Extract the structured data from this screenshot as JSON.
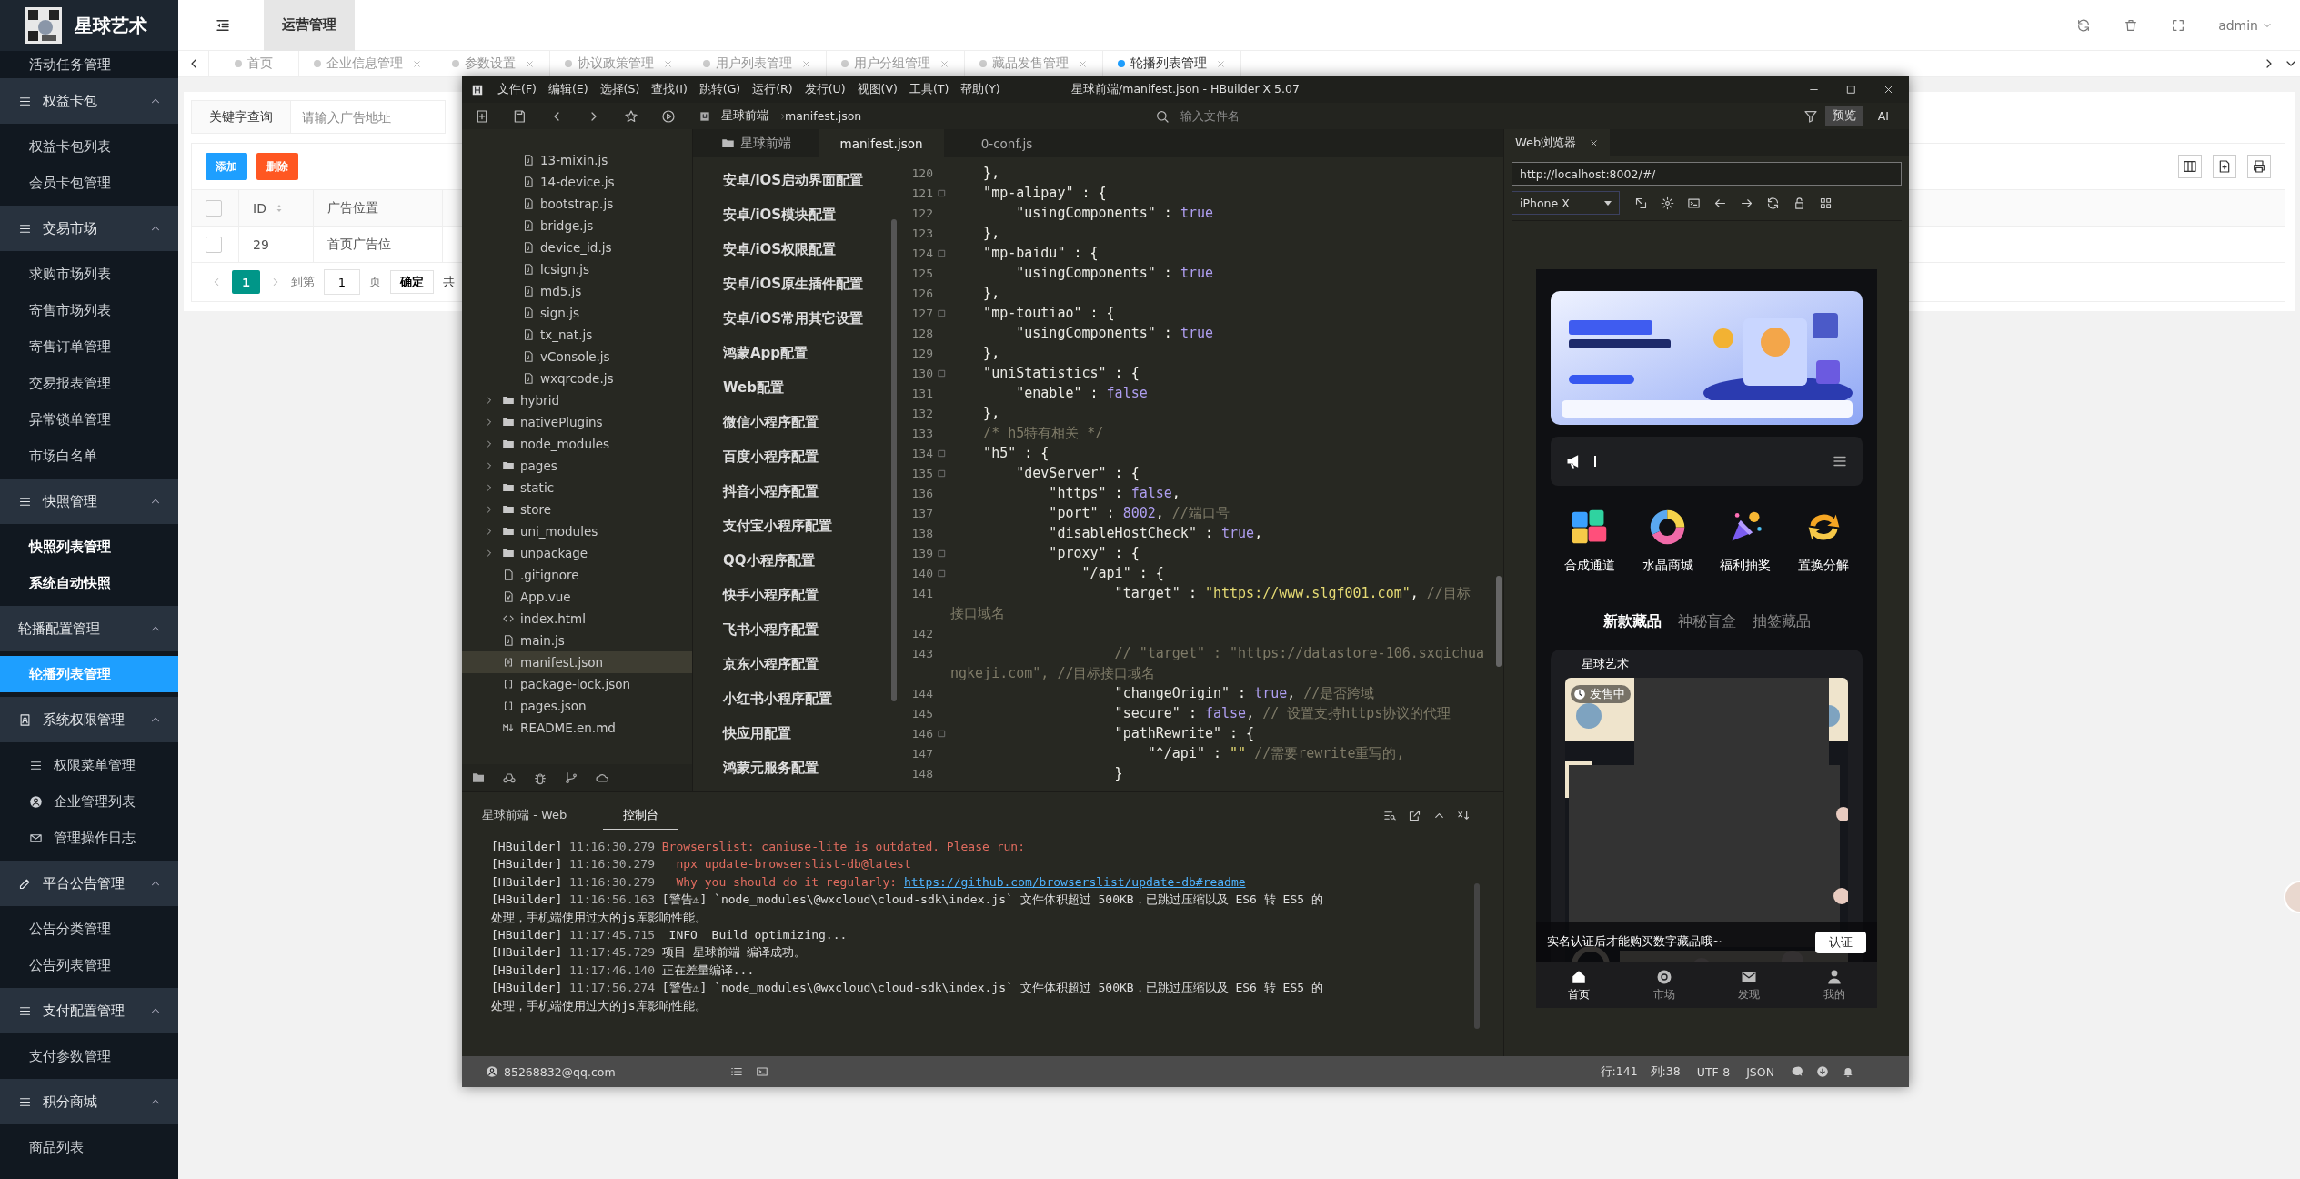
{
  "admin": {
    "logo": "星球艺术",
    "sidebar": {
      "partial_item": "活动任务管理",
      "groups": [
        {
          "title": "权益卡包",
          "kind": "list",
          "expanded": true,
          "items": [
            {
              "label": "权益卡包列表",
              "selected": false,
              "emphasized": false
            },
            {
              "label": "会员卡包管理",
              "selected": false,
              "emphasized": false
            }
          ]
        },
        {
          "title": "交易市场",
          "kind": "list",
          "expanded": true,
          "items": [
            {
              "label": "求购市场列表",
              "selected": false,
              "emphasized": false
            },
            {
              "label": "寄售市场列表",
              "selected": false,
              "emphasized": false
            },
            {
              "label": "寄售订单管理",
              "selected": false,
              "emphasized": false
            },
            {
              "label": "交易报表管理",
              "selected": false,
              "emphasized": false
            },
            {
              "label": "异常锁单管理",
              "selected": false,
              "emphasized": false
            },
            {
              "label": "市场白名单",
              "selected": false,
              "emphasized": false
            }
          ]
        },
        {
          "title": "快照管理",
          "kind": "list",
          "expanded": true,
          "items": [
            {
              "label": "快照列表管理",
              "selected": false,
              "emphasized": true
            },
            {
              "label": "系统自动快照",
              "selected": false,
              "emphasized": true
            }
          ]
        },
        {
          "title": "轮播配置管理",
          "kind": "plain",
          "expanded": true,
          "items": [
            {
              "label": "轮播列表管理",
              "selected": true
            }
          ]
        },
        {
          "title": "系统权限管理",
          "kind": "contact",
          "expanded": true,
          "items": [
            {
              "label": "权限菜单管理",
              "kind": "list",
              "selected": false,
              "emphasized": false
            },
            {
              "label": "企业管理列表",
              "kind": "user",
              "selected": false,
              "emphasized": false
            },
            {
              "label": "管理操作日志",
              "kind": "mail",
              "selected": false,
              "emphasized": false
            }
          ]
        },
        {
          "title": "平台公告管理",
          "kind": "edit",
          "expanded": true,
          "items": [
            {
              "label": "公告分类管理",
              "selected": false,
              "emphasized": false
            },
            {
              "label": "公告列表管理",
              "selected": false,
              "emphasized": false
            }
          ]
        },
        {
          "title": "支付配置管理",
          "kind": "list",
          "expanded": true,
          "items": [
            {
              "label": "支付参数管理",
              "selected": false,
              "emphasized": false
            }
          ]
        },
        {
          "title": "积分商城",
          "kind": "list",
          "expanded": true,
          "items": [
            {
              "label": "商品列表",
              "selected": false,
              "emphasized": false
            }
          ]
        }
      ]
    },
    "top_menu": "运营管理",
    "user": "admin",
    "tabs": [
      {
        "label": "首页",
        "closable": false,
        "selected": false
      },
      {
        "label": "企业信息管理",
        "closable": true,
        "selected": false
      },
      {
        "label": "参数设置",
        "closable": true,
        "selected": false
      },
      {
        "label": "协议政策管理",
        "closable": true,
        "selected": false
      },
      {
        "label": "用户列表管理",
        "closable": true,
        "selected": false
      },
      {
        "label": "用户分组管理",
        "closable": true,
        "selected": false
      },
      {
        "label": "藏品发售管理",
        "closable": true,
        "selected": false
      },
      {
        "label": "轮播列表管理",
        "closable": true,
        "selected": true
      }
    ],
    "search": {
      "label": "关键字查询",
      "placeholder": "请输入广告地址"
    },
    "actions": [
      {
        "label": "添加",
        "kind": "primary"
      },
      {
        "label": "删除",
        "kind": "danger"
      }
    ],
    "table": {
      "header_checked": false,
      "columns": [
        "ID",
        "广告位置"
      ],
      "rows": [
        {
          "checked": false,
          "cells": [
            "29",
            "首页广告位"
          ]
        }
      ]
    },
    "pagination": {
      "pages": [
        {
          "label": "1",
          "selected": true
        }
      ],
      "goto_label": "到第",
      "goto_value": "1",
      "page_unit": "页",
      "confirm": "确定",
      "total": "共"
    }
  },
  "ide": {
    "title": "星球前端/manifest.json - HBuilder X 5.07",
    "menus": [
      "文件(F)",
      "编辑(E)",
      "选择(S)",
      "查找(I)",
      "跳转(G)",
      "运行(R)",
      "发行(U)",
      "视图(V)",
      "工具(T)",
      "帮助(Y)"
    ],
    "breadcrumb": [
      "星球前端",
      "manifest.json"
    ],
    "file_search_placeholder": "输入文件名",
    "preview_button": "预览",
    "ai_button": "AI",
    "file_tree": {
      "inner_files": [
        {
          "name": "13-mixin.js",
          "kind": "file",
          "selected": false
        },
        {
          "name": "14-device.js",
          "kind": "file",
          "selected": false
        },
        {
          "name": "bootstrap.js",
          "kind": "file",
          "selected": false
        },
        {
          "name": "bridge.js",
          "kind": "file",
          "selected": false
        },
        {
          "name": "device_id.js",
          "kind": "file",
          "selected": false
        },
        {
          "name": "lcsign.js",
          "kind": "file",
          "selected": false
        },
        {
          "name": "md5.js",
          "kind": "file",
          "selected": false
        },
        {
          "name": "sign.js",
          "kind": "file",
          "selected": false
        },
        {
          "name": "tx_nat.js",
          "kind": "file",
          "selected": false
        },
        {
          "name": "vConsole.js",
          "kind": "file",
          "selected": false
        },
        {
          "name": "wxqrcode.js",
          "kind": "file",
          "selected": false
        }
      ],
      "items": [
        {
          "name": "hybrid",
          "kind": "folder",
          "expanded": false,
          "selected": false
        },
        {
          "name": "nativePlugins",
          "kind": "folder",
          "expanded": false,
          "selected": false
        },
        {
          "name": "node_modules",
          "kind": "folder",
          "expanded": false,
          "selected": false
        },
        {
          "name": "pages",
          "kind": "folder",
          "expanded": false,
          "selected": false
        },
        {
          "name": "static",
          "kind": "folder",
          "expanded": false,
          "selected": false
        },
        {
          "name": "store",
          "kind": "folder",
          "expanded": false,
          "selected": false
        },
        {
          "name": "uni_modules",
          "kind": "folder",
          "expanded": false,
          "selected": false
        },
        {
          "name": "unpackage",
          "kind": "folder",
          "expanded": false,
          "selected": false
        },
        {
          "name": ".gitignore",
          "kind": "blank",
          "selected": false
        },
        {
          "name": "App.vue",
          "kind": "vue",
          "selected": false
        },
        {
          "name": "index.html",
          "kind": "html",
          "selected": false
        },
        {
          "name": "main.js",
          "kind": "file",
          "selected": false
        },
        {
          "name": "manifest.json",
          "kind": "manifest",
          "selected": true
        },
        {
          "name": "package-lock.json",
          "kind": "json",
          "selected": false
        },
        {
          "name": "pages.json",
          "kind": "json",
          "selected": false
        },
        {
          "name": "README.en.md",
          "kind": "md",
          "selected": false
        }
      ]
    },
    "editor_tabs": [
      {
        "label": "星球前端",
        "kind": "folder",
        "selected": false
      },
      {
        "label": "manifest.json",
        "kind": "file",
        "selected": true
      },
      {
        "label": "0-conf.js",
        "kind": "file",
        "selected": false
      }
    ],
    "manifest_sections": [
      "安卓/iOS启动界面配置",
      "安卓/iOS模块配置",
      "安卓/iOS权限配置",
      "安卓/iOS原生插件配置",
      "安卓/iOS常用其它设置",
      "鸿蒙App配置",
      "Web配置",
      "微信小程序配置",
      "百度小程序配置",
      "抖音小程序配置",
      "支付宝小程序配置",
      "QQ小程序配置",
      "快手小程序配置",
      "飞书小程序配置",
      "京东小程序配置",
      "小红书小程序配置",
      "快应用配置",
      "鸿蒙元服务配置"
    ],
    "code_lines": [
      {
        "no": "120",
        "fold": false,
        "tokens": [
          {
            "kind": "punct",
            "text": "    },"
          }
        ]
      },
      {
        "no": "121",
        "fold": true,
        "tokens": [
          {
            "kind": "key",
            "text": "    \"mp-alipay\""
          },
          {
            "kind": "punct",
            "text": " : {"
          }
        ]
      },
      {
        "no": "122",
        "fold": false,
        "tokens": [
          {
            "kind": "key",
            "text": "        \"usingComponents\""
          },
          {
            "kind": "punct",
            "text": " : "
          },
          {
            "kind": "literal",
            "text": "true"
          }
        ]
      },
      {
        "no": "123",
        "fold": false,
        "tokens": [
          {
            "kind": "punct",
            "text": "    },"
          }
        ]
      },
      {
        "no": "124",
        "fold": true,
        "tokens": [
          {
            "kind": "key",
            "text": "    \"mp-baidu\""
          },
          {
            "kind": "punct",
            "text": " : {"
          }
        ]
      },
      {
        "no": "125",
        "fold": false,
        "tokens": [
          {
            "kind": "key",
            "text": "        \"usingComponents\""
          },
          {
            "kind": "punct",
            "text": " : "
          },
          {
            "kind": "literal",
            "text": "true"
          }
        ]
      },
      {
        "no": "126",
        "fold": false,
        "tokens": [
          {
            "kind": "punct",
            "text": "    },"
          }
        ]
      },
      {
        "no": "127",
        "fold": true,
        "tokens": [
          {
            "kind": "key",
            "text": "    \"mp-toutiao\""
          },
          {
            "kind": "punct",
            "text": " : {"
          }
        ]
      },
      {
        "no": "128",
        "fold": false,
        "tokens": [
          {
            "kind": "key",
            "text": "        \"usingComponents\""
          },
          {
            "kind": "punct",
            "text": " : "
          },
          {
            "kind": "literal",
            "text": "true"
          }
        ]
      },
      {
        "no": "129",
        "fold": false,
        "tokens": [
          {
            "kind": "punct",
            "text": "    },"
          }
        ]
      },
      {
        "no": "130",
        "fold": true,
        "tokens": [
          {
            "kind": "key",
            "text": "    \"uniStatistics\""
          },
          {
            "kind": "punct",
            "text": " : {"
          }
        ]
      },
      {
        "no": "131",
        "fold": false,
        "tokens": [
          {
            "kind": "key",
            "text": "        \"enable\""
          },
          {
            "kind": "punct",
            "text": " : "
          },
          {
            "kind": "literal",
            "text": "false"
          }
        ]
      },
      {
        "no": "132",
        "fold": false,
        "tokens": [
          {
            "kind": "punct",
            "text": "    },"
          }
        ]
      },
      {
        "no": "133",
        "fold": false,
        "tokens": [
          {
            "kind": "comment",
            "text": "    /* h5特有相关 */"
          }
        ]
      },
      {
        "no": "134",
        "fold": true,
        "tokens": [
          {
            "kind": "key",
            "text": "    \"h5\""
          },
          {
            "kind": "punct",
            "text": " : {"
          }
        ]
      },
      {
        "no": "135",
        "fold": true,
        "tokens": [
          {
            "kind": "key",
            "text": "        \"devServer\""
          },
          {
            "kind": "punct",
            "text": " : {"
          }
        ]
      },
      {
        "no": "136",
        "fold": false,
        "tokens": [
          {
            "kind": "key",
            "text": "            \"https\""
          },
          {
            "kind": "punct",
            "text": " : "
          },
          {
            "kind": "literal",
            "text": "false"
          },
          {
            "kind": "punct",
            "text": ","
          }
        ]
      },
      {
        "no": "137",
        "fold": false,
        "tokens": [
          {
            "kind": "key",
            "text": "            \"port\""
          },
          {
            "kind": "punct",
            "text": " : "
          },
          {
            "kind": "literal",
            "text": "8002"
          },
          {
            "kind": "punct",
            "text": ", "
          },
          {
            "kind": "comment",
            "text": "//端口号"
          }
        ]
      },
      {
        "no": "138",
        "fold": false,
        "tokens": [
          {
            "kind": "key",
            "text": "            \"disableHostCheck\""
          },
          {
            "kind": "punct",
            "text": " : "
          },
          {
            "kind": "literal",
            "text": "true"
          },
          {
            "kind": "punct",
            "text": ","
          }
        ]
      },
      {
        "no": "139",
        "fold": true,
        "tokens": [
          {
            "kind": "key",
            "text": "            \"proxy\""
          },
          {
            "kind": "punct",
            "text": " : {"
          }
        ]
      },
      {
        "no": "140",
        "fold": true,
        "tokens": [
          {
            "kind": "key",
            "text": "                \"/api\""
          },
          {
            "kind": "punct",
            "text": " : {"
          }
        ]
      },
      {
        "no": "141",
        "fold": false,
        "tokens": [
          {
            "kind": "key",
            "text": "                    \"target\""
          },
          {
            "kind": "punct",
            "text": " : "
          },
          {
            "kind": "string",
            "text": "\"https://www.slgf001.com\""
          },
          {
            "kind": "punct",
            "text": ", "
          },
          {
            "kind": "comment",
            "text": "//目标"
          }
        ]
      },
      {
        "fold": false,
        "tokens": [
          {
            "kind": "comment",
            "text": "接口域名"
          }
        ]
      },
      {
        "no": "142",
        "fold": false
      },
      {
        "no": "143",
        "fold": false,
        "tokens": [
          {
            "kind": "comment",
            "text": "                    // \"target\" : \"https://datastore-106.sxqichua"
          }
        ]
      },
      {
        "fold": false,
        "tokens": [
          {
            "kind": "comment",
            "text": "ngkeji.com\", //目标接口域名"
          }
        ]
      },
      {
        "no": "144",
        "fold": false,
        "tokens": [
          {
            "kind": "key",
            "text": "                    \"changeOrigin\""
          },
          {
            "kind": "punct",
            "text": " : "
          },
          {
            "kind": "literal",
            "text": "true"
          },
          {
            "kind": "punct",
            "text": ", "
          },
          {
            "kind": "comment",
            "text": "//是否跨域"
          }
        ]
      },
      {
        "no": "145",
        "fold": false,
        "tokens": [
          {
            "kind": "key",
            "text": "                    \"secure\""
          },
          {
            "kind": "punct",
            "text": " : "
          },
          {
            "kind": "literal",
            "text": "false"
          },
          {
            "kind": "punct",
            "text": ", "
          },
          {
            "kind": "comment",
            "text": "// 设置支持https协议的代理"
          }
        ]
      },
      {
        "no": "146",
        "fold": true,
        "tokens": [
          {
            "kind": "key",
            "text": "                    \"pathRewrite\""
          },
          {
            "kind": "punct",
            "text": " : {"
          }
        ]
      },
      {
        "no": "147",
        "fold": false,
        "tokens": [
          {
            "kind": "key",
            "text": "                        \"^/api\""
          },
          {
            "kind": "punct",
            "text": " : "
          },
          {
            "kind": "string",
            "text": "\"\""
          },
          {
            "kind": "comment",
            "text": " //需要rewrite重写的,"
          }
        ]
      },
      {
        "no": "148",
        "fold": false,
        "tokens": [
          {
            "kind": "punct",
            "text": "                    }"
          }
        ]
      }
    ],
    "bottom_tabs": [
      {
        "label": "星球前端 - Web",
        "selected": false
      },
      {
        "label": "控制台",
        "selected": true
      }
    ],
    "console": [
      {
        "source": "[HBuilder]",
        "time": "11:16:30.279",
        "parts": [
          {
            "kind": "error",
            "text": "Browserslist: caniuse-lite is outdated. Please run:"
          }
        ]
      },
      {
        "source": "[HBuilder]",
        "time": "11:16:30.279",
        "parts": [
          {
            "kind": "error",
            "text": "  npx update-browserslist-db@latest"
          }
        ]
      },
      {
        "source": "[HBuilder]",
        "time": "11:16:30.279",
        "parts": [
          {
            "kind": "error",
            "text": "  Why you should do it regularly: "
          },
          {
            "kind": "link",
            "text": "https://github.com/browserslist/update-db#readme"
          }
        ]
      },
      {
        "source": "[HBuilder]",
        "time": "11:16:56.163",
        "parts": [
          {
            "kind": "plain",
            "text": "[警告⚠] `node_modules\\@wxcloud\\cloud-sdk\\index.js` 文件体积超过 500KB，已跳过压缩以及 ES6 转 ES5 的"
          }
        ]
      },
      {
        "parts": [
          {
            "kind": "plain",
            "text": "处理，手机端使用过大的js库影响性能。"
          }
        ]
      },
      {
        "source": "[HBuilder]",
        "time": "11:17:45.715",
        "parts": [
          {
            "kind": "plain",
            "text": " INFO  Build optimizing..."
          }
        ]
      },
      {
        "source": "[HBuilder]",
        "time": "11:17:45.729",
        "parts": [
          {
            "kind": "plain",
            "text": "项目 星球前端 编译成功。"
          }
        ]
      },
      {
        "source": "[HBuilder]",
        "time": "11:17:46.140",
        "parts": [
          {
            "kind": "plain",
            "text": "正在差量编译..."
          }
        ]
      },
      {
        "source": "[HBuilder]",
        "time": "11:17:56.274",
        "parts": [
          {
            "kind": "plain",
            "text": "[警告⚠] `node_modules\\@wxcloud\\cloud-sdk\\index.js` 文件体积超过 500KB，已跳过压缩以及 ES6 转 ES5 的"
          }
        ]
      },
      {
        "parts": [
          {
            "kind": "plain",
            "text": "处理，手机端使用过大的js库影响性能。"
          }
        ]
      }
    ],
    "status_bar": {
      "account": "85268832@qq.com",
      "line": "行:141",
      "column": "列:38",
      "encoding": "UTF-8",
      "language": "JSON"
    },
    "browser": {
      "tab": "Web浏览器",
      "url": "http://localhost:8002/#/",
      "device": "iPhone X",
      "phone": {
        "shortcuts": [
          {
            "label": "合成通道",
            "kind": "puzzle"
          },
          {
            "label": "水晶商城",
            "kind": "ring"
          },
          {
            "label": "福利抽奖",
            "kind": "party"
          },
          {
            "label": "置换分解",
            "kind": "swap"
          }
        ],
        "tabs": [
          {
            "label": "新款藏品",
            "selected": true
          },
          {
            "label": "神秘盲盒",
            "selected": false
          },
          {
            "label": "抽签藏品",
            "selected": false
          }
        ],
        "card": {
          "title": "星球艺术",
          "badge": "发售中"
        },
        "notice": {
          "text": "实名认证后才能购买数字藏品哦~",
          "button": "认证"
        },
        "tabbar": [
          {
            "label": "首页",
            "kind": "home",
            "selected": true
          },
          {
            "label": "市场",
            "kind": "market",
            "selected": false
          },
          {
            "label": "发现",
            "kind": "mail",
            "selected": false
          },
          {
            "label": "我的",
            "kind": "person",
            "selected": false
          }
        ]
      }
    }
  }
}
